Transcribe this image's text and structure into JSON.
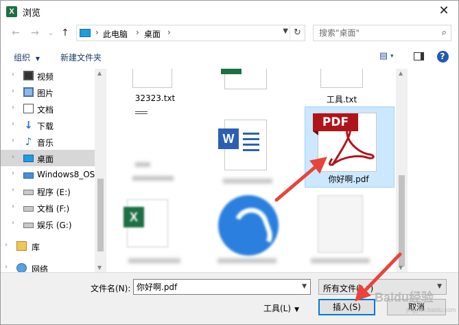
{
  "window": {
    "title": "浏览",
    "app_icon_letter": "X",
    "close_glyph": "✕"
  },
  "nav": {
    "back_glyph": "←",
    "forward_glyph": "→",
    "recent_glyph": "⌄",
    "up_glyph": "↑",
    "breadcrumb": [
      "此电脑",
      "桌面"
    ],
    "crumb_sep": "›",
    "refresh_glyph": "↻",
    "search_placeholder": "搜索\"桌面\"",
    "search_glyph": "⌕"
  },
  "commands": {
    "organize": "组织",
    "organize_dd": "▼",
    "new_folder": "新建文件夹",
    "view_glyph": "▤",
    "view_dd": "▾",
    "help_glyph": "?"
  },
  "sidebar": {
    "items": [
      {
        "label": "视频",
        "icon": "video-icon"
      },
      {
        "label": "图片",
        "icon": "pictures-icon"
      },
      {
        "label": "文档",
        "icon": "documents-icon"
      },
      {
        "label": "下载",
        "icon": "downloads-icon"
      },
      {
        "label": "音乐",
        "icon": "music-icon"
      },
      {
        "label": "桌面",
        "icon": "desktop-icon",
        "selected": true
      },
      {
        "label": "Windows8_OS",
        "icon": "windows-drive-icon"
      },
      {
        "label": "程序 (E:)",
        "icon": "drive-icon"
      },
      {
        "label": "文档 (F:)",
        "icon": "drive-icon"
      },
      {
        "label": "娱乐 (G:)",
        "icon": "drive-icon"
      },
      {
        "label": "库",
        "icon": "library-icon"
      },
      {
        "label": "网络",
        "icon": "network-icon"
      }
    ],
    "chevron": "›"
  },
  "files": [
    {
      "name": "32323.txt"
    },
    {
      "name": "工具.txt"
    },
    {
      "name": "你好啊.pdf",
      "selected": true,
      "banner": "PDF"
    },
    {
      "name": "",
      "icon_letter": "W"
    },
    {
      "name": "",
      "icon_letter": "X"
    }
  ],
  "bottom": {
    "filename_label": "文件名(N):",
    "filename_value": "你好啊.pdf",
    "filetype_value": "所有文件(*.*)",
    "dd_glyph": "▼",
    "tools_label": "工具(L)",
    "insert_label": "插入(S)",
    "cancel_label": "取消"
  },
  "watermark": {
    "text": "Baidu经验",
    "sub": "jingyan.baidu.com"
  },
  "colors": {
    "accent": "#0078d7",
    "selection": "#cce8ff",
    "annotation": "#e8443a",
    "pdf_red": "#b0141b"
  }
}
